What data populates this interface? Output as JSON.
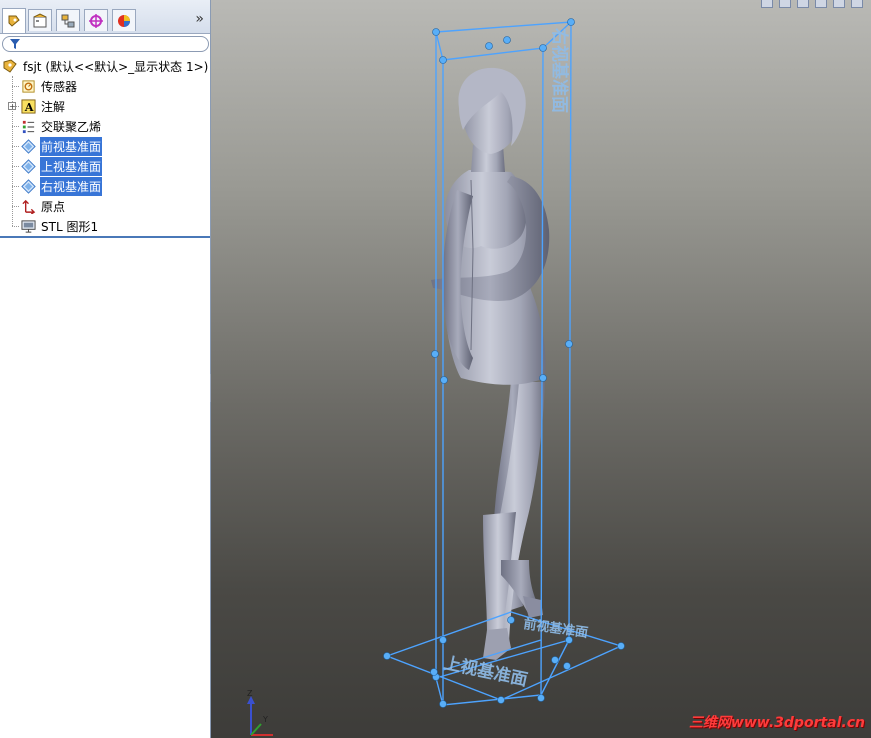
{
  "feature_tree": {
    "root_label": "fsjt  (默认<<默认>_显示状态 1>)",
    "items": [
      {
        "label": "传感器",
        "icon": "sensor-icon",
        "selected": false,
        "expandable": false
      },
      {
        "label": "注解",
        "icon": "annotation-icon",
        "selected": false,
        "expandable": true
      },
      {
        "label": "交联聚乙烯",
        "icon": "material-icon",
        "selected": false,
        "expandable": false
      },
      {
        "label": "前视基准面",
        "icon": "plane-icon",
        "selected": true,
        "expandable": false
      },
      {
        "label": "上视基准面",
        "icon": "plane-icon",
        "selected": true,
        "expandable": false
      },
      {
        "label": "右视基准面",
        "icon": "plane-icon",
        "selected": true,
        "expandable": false
      },
      {
        "label": "原点",
        "icon": "origin-icon",
        "selected": false,
        "expandable": false
      },
      {
        "label": "STL 图形1",
        "icon": "stl-graphic-icon",
        "selected": false,
        "expandable": false
      }
    ]
  },
  "tabs": [
    "feature-manager-tab",
    "property-manager-tab",
    "configuration-manager-tab",
    "dimxpert-tab",
    "display-manager-tab"
  ],
  "viewport": {
    "plane_labels": {
      "right": "右视基准面",
      "top": "上视基准面",
      "front": "前视基准面"
    },
    "triad_axes": {
      "z": "Z",
      "y": "Y"
    },
    "highlight_color": "#4da3ff",
    "watermark": "三维网www.3dportal.cn"
  }
}
